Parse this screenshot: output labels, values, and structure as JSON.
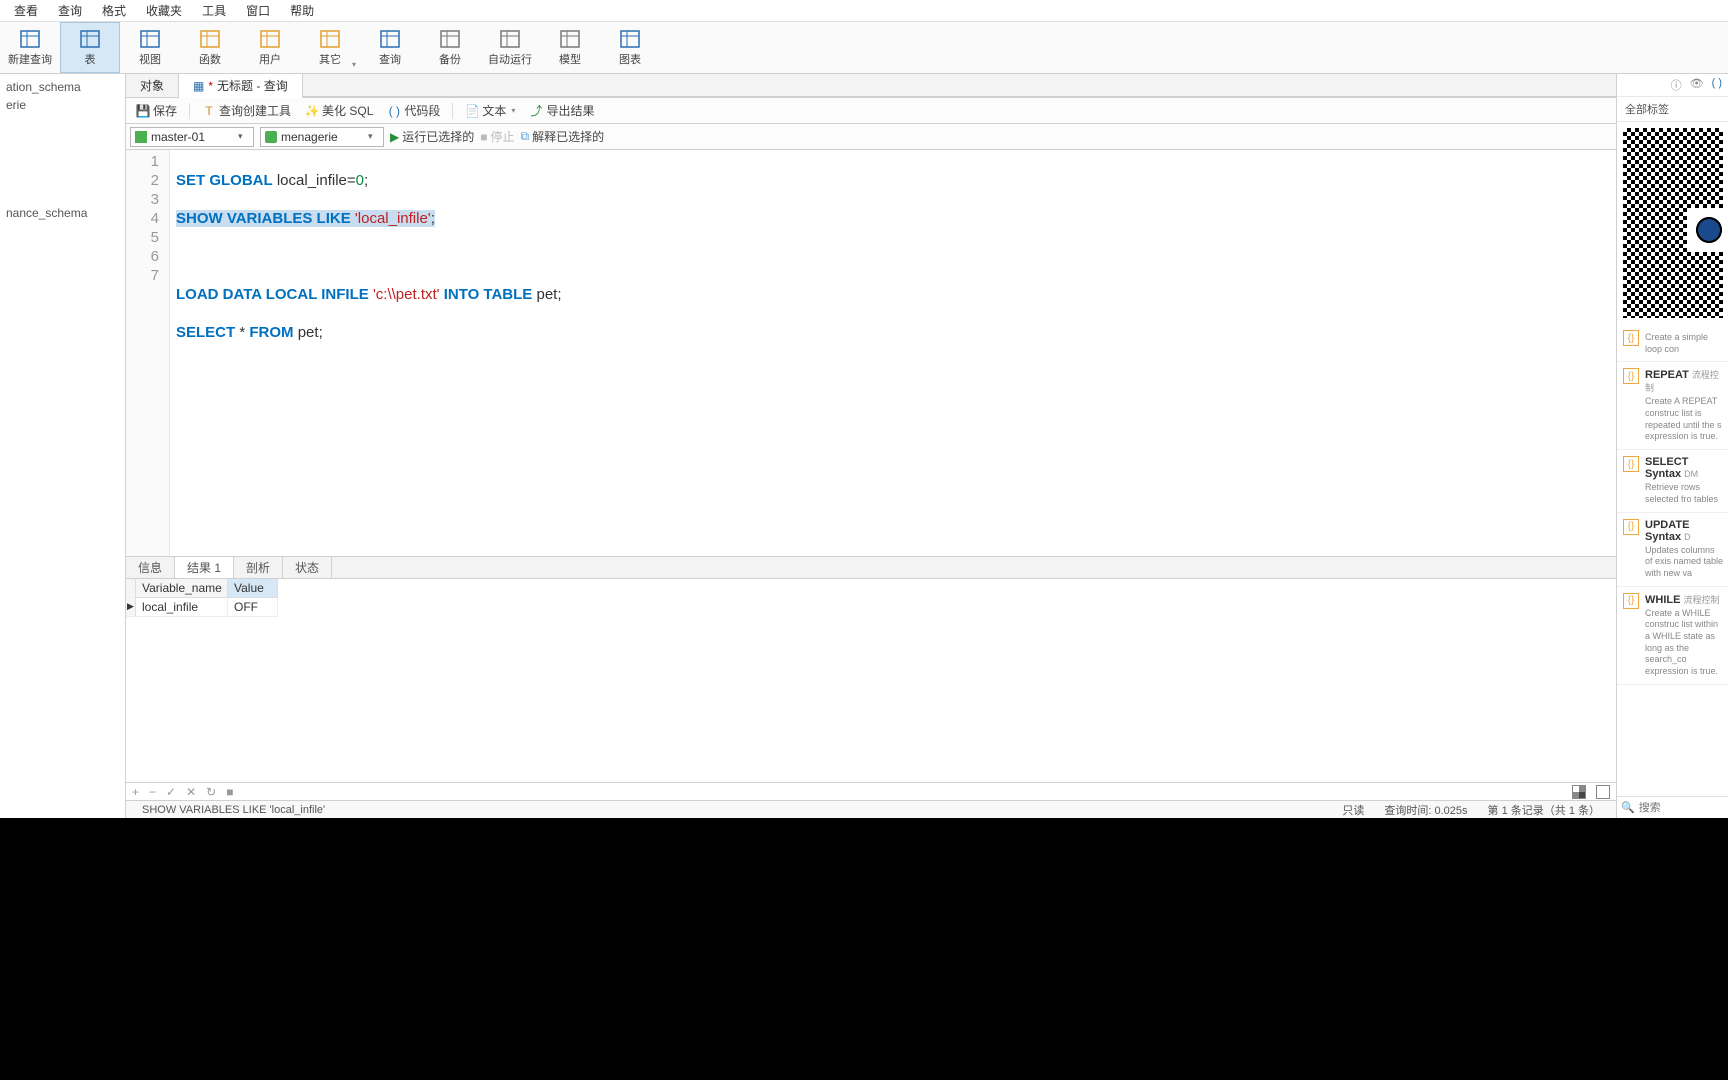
{
  "menu": [
    "查看",
    "查询",
    "格式",
    "收藏夹",
    "工具",
    "窗口",
    "帮助"
  ],
  "ribbon": [
    {
      "label": "新建查询",
      "color": "#2b6fb3"
    },
    {
      "label": "表",
      "color": "#2b6fb3",
      "active": true
    },
    {
      "label": "视图",
      "color": "#2b6fb3"
    },
    {
      "label": "函数",
      "color": "#e2a030"
    },
    {
      "label": "用户",
      "color": "#e2a030"
    },
    {
      "label": "其它",
      "color": "#e2a030",
      "caret": true
    },
    {
      "label": "查询",
      "color": "#2b6fb3"
    },
    {
      "label": "备份",
      "color": "#777"
    },
    {
      "label": "自动运行",
      "color": "#777"
    },
    {
      "label": "模型",
      "color": "#777"
    },
    {
      "label": "图表",
      "color": "#2b6fb3"
    }
  ],
  "sidebar_items": [
    "ation_schema",
    "erie",
    "",
    "",
    "",
    "",
    "",
    "nance_schema"
  ],
  "tabs": [
    {
      "label": "对象"
    },
    {
      "label": "无标题 - 查询",
      "active": true,
      "dirty": true
    }
  ],
  "toolbar": {
    "save": "保存",
    "builder": "查询创建工具",
    "beautify": "美化 SQL",
    "snippet": "代码段",
    "text": "文本",
    "export": "导出结果"
  },
  "selectors": {
    "conn": "master-01",
    "db": "menagerie",
    "run": "运行已选择的",
    "stop": "停止",
    "explain": "解释已选择的"
  },
  "code": {
    "lines": [
      1,
      2,
      3,
      4,
      5,
      6,
      7
    ],
    "l1": {
      "a": "SET GLOBAL",
      "b": " local_infile=",
      "c": "0",
      "d": ";"
    },
    "l2": {
      "a": "SHOW VARIABLES LIKE ",
      "b": "'local_infile'",
      "c": ";"
    },
    "l4": {
      "a": "LOAD DATA LOCAL INFILE ",
      "b": "'c:\\\\pet.txt'",
      "c": " INTO TABLE",
      "d": " pet;"
    },
    "l5": {
      "a": "SELECT",
      "b": " * ",
      "c": "FROM",
      "d": " pet;"
    }
  },
  "right": {
    "title": "全部标签",
    "snippets": [
      {
        "title": "",
        "tag": "",
        "desc": "Create a simple loop con"
      },
      {
        "title": "REPEAT",
        "tag": "流程控制",
        "desc": "Create A REPEAT construc list is repeated until the s expression is true."
      },
      {
        "title": "SELECT Syntax",
        "tag": "DM",
        "desc": "Retrieve rows selected fro tables"
      },
      {
        "title": "UPDATE Syntax",
        "tag": "D",
        "desc": "Updates columns of exis named table with new va"
      },
      {
        "title": "WHILE",
        "tag": "流程控制",
        "desc": "Create a WHILE construc list within a WHILE state as long as the search_co expression is true."
      }
    ],
    "search_placeholder": "搜索"
  },
  "results": {
    "tabs": [
      "信息",
      "结果 1",
      "剖析",
      "状态"
    ],
    "active": 1,
    "columns": [
      "Variable_name",
      "Value"
    ],
    "rows": [
      [
        "local_infile",
        "OFF"
      ]
    ]
  },
  "status": {
    "query": "SHOW VARIABLES LIKE 'local_infile'",
    "readonly": "只读",
    "time": "查询时间: 0.025s",
    "records": "第 1 条记录（共 1 条）"
  }
}
